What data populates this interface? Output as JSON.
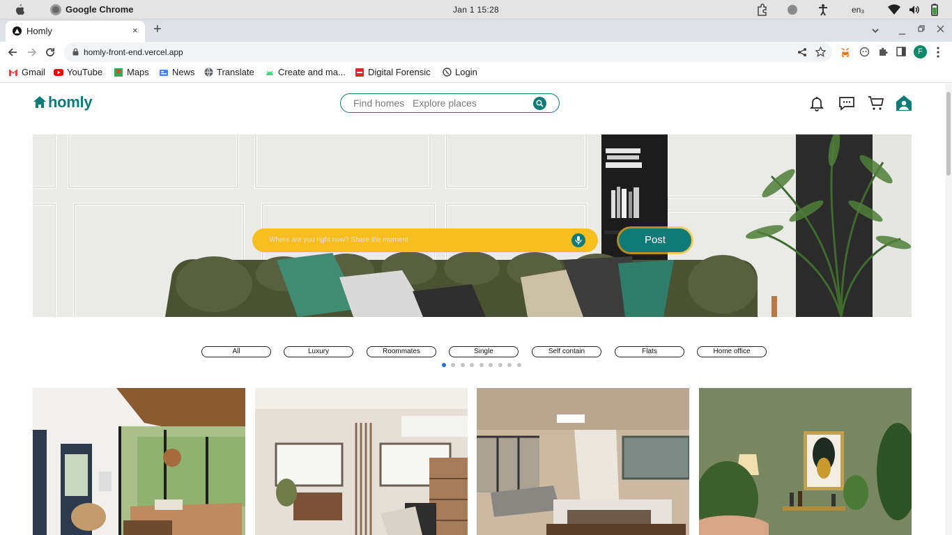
{
  "os": {
    "app_name": "Google Chrome",
    "clock": "Jan 1  15:28",
    "language": "en₃"
  },
  "browser": {
    "tab_title": "Homly",
    "close_tab": "×",
    "new_tab": "+",
    "url": "homly-front-end.vercel.app",
    "profile_initial": "F"
  },
  "bookmarks": [
    {
      "label": "Gmail",
      "color": "#ea4335"
    },
    {
      "label": "YouTube",
      "color": "#ff0000"
    },
    {
      "label": "Maps",
      "color": "#34a853"
    },
    {
      "label": "News",
      "color": "#4285f4"
    },
    {
      "label": "Translate",
      "color": "#5f6368"
    },
    {
      "label": "Create and ma...",
      "color": "#3ddc84"
    },
    {
      "label": "Digital Forensic",
      "color": "#d32f2f"
    },
    {
      "label": "Login",
      "color": "#444444"
    }
  ],
  "site": {
    "logo_text": "homly",
    "brand_color": "#0f7b78",
    "search": {
      "placeholder_homes": "Find homes",
      "placeholder_places": "Explore places"
    },
    "header_icons": [
      "bell-icon",
      "chat-icon",
      "cart-icon",
      "profile-house-icon"
    ]
  },
  "hero": {
    "moment_placeholder": "Where are you right now? Share the moment",
    "post_label": "Post",
    "accent_color": "#f7be1f"
  },
  "categories": [
    "All",
    "Luxury",
    "Roommates",
    "Single",
    "Self contain",
    "Flats",
    "Home office"
  ],
  "carousel": {
    "dot_count": 9,
    "active_index": 0
  }
}
